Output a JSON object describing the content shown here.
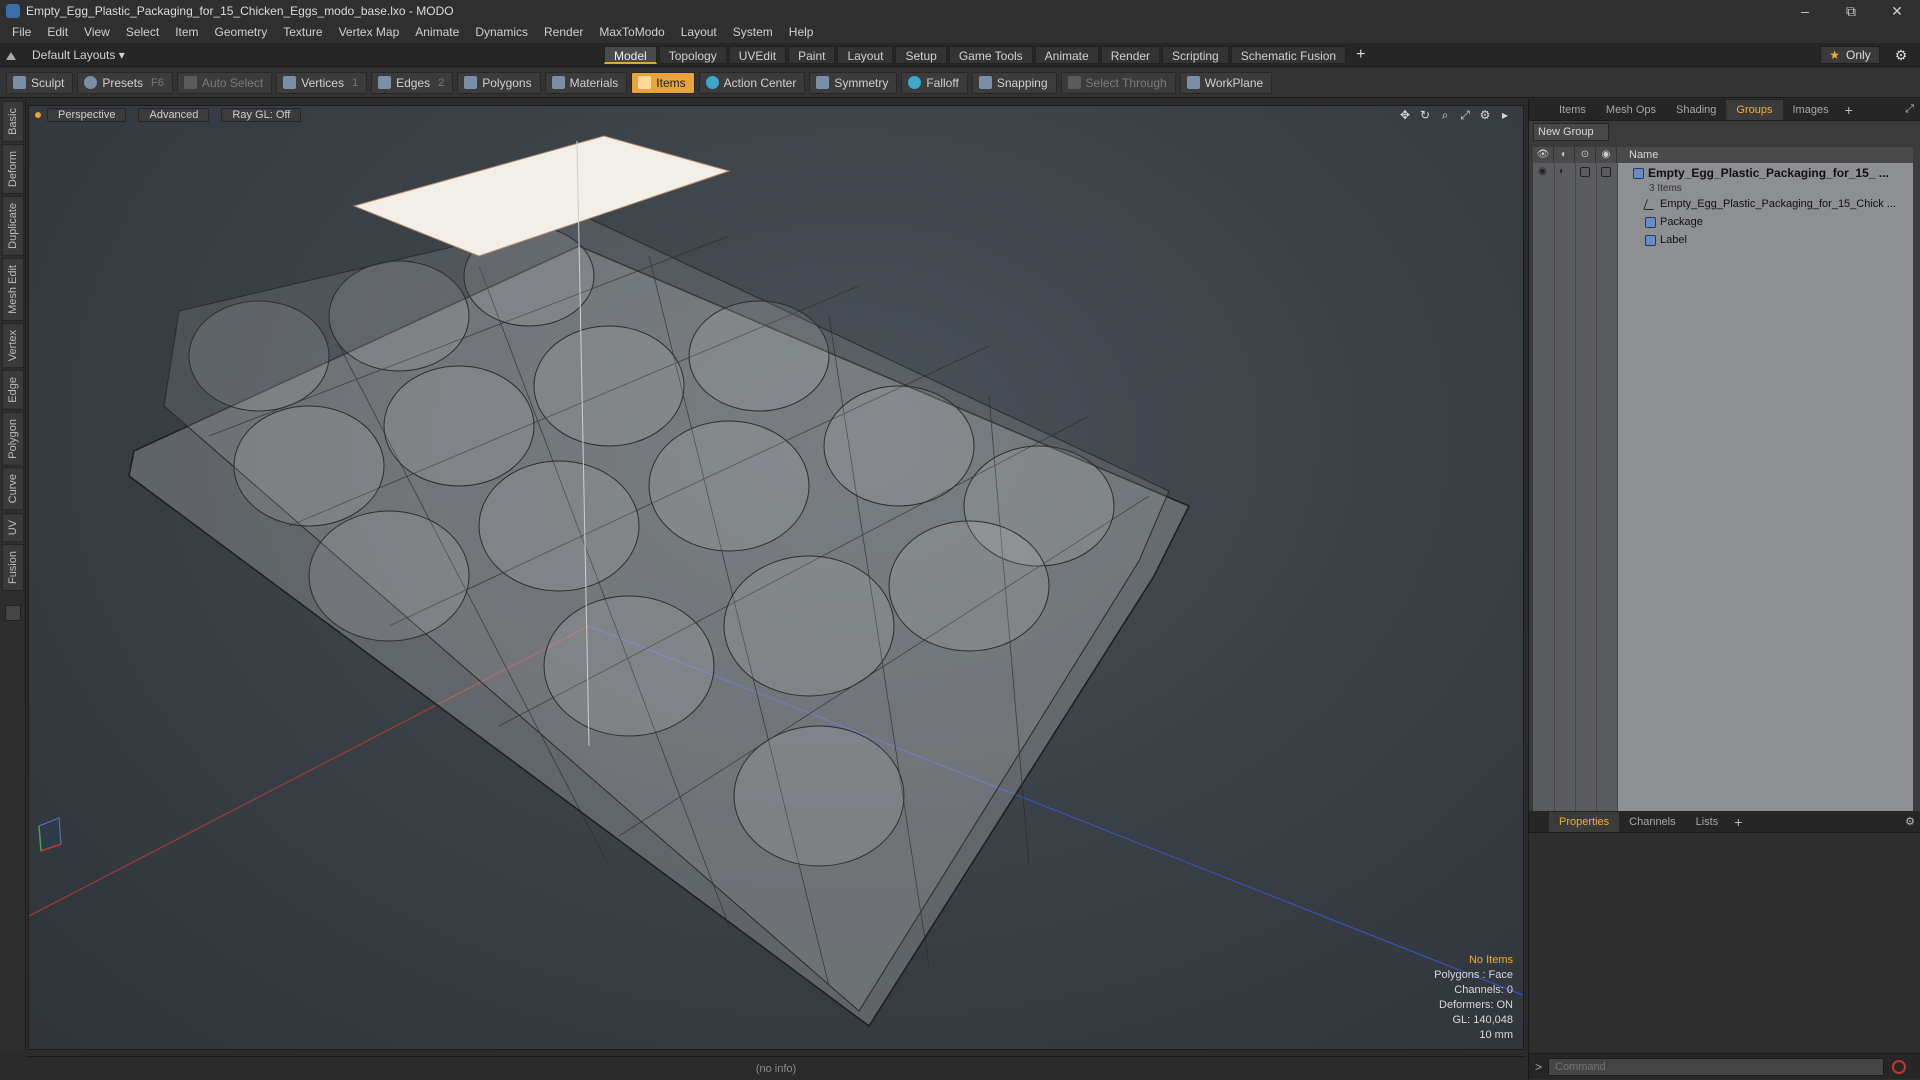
{
  "window": {
    "title": "Empty_Egg_Plastic_Packaging_for_15_Chicken_Eggs_modo_base.lxo - MODO",
    "minimize": "–",
    "maximize": "⧉",
    "close": "✕"
  },
  "menu": [
    "File",
    "Edit",
    "View",
    "Select",
    "Item",
    "Geometry",
    "Texture",
    "Vertex Map",
    "Animate",
    "Dynamics",
    "Render",
    "MaxToModo",
    "Layout",
    "System",
    "Help"
  ],
  "layout_selector": "Default Layouts ▾",
  "tabs": [
    "Model",
    "Topology",
    "UVEdit",
    "Paint",
    "Layout",
    "Setup",
    "Game Tools",
    "Animate",
    "Render",
    "Scripting",
    "Schematic Fusion"
  ],
  "active_tab": "Model",
  "tab_plus": "+",
  "only_label": "Only",
  "toolbar": {
    "sculpt": "Sculpt",
    "presets": "Presets",
    "presets_key": "F6",
    "auto_select": "Auto Select",
    "vertices": "Vertices",
    "vertices_key": "1",
    "edges": "Edges",
    "edges_key": "2",
    "polygons": "Polygons",
    "materials": "Materials",
    "items": "Items",
    "action_center": "Action Center",
    "symmetry": "Symmetry",
    "falloff": "Falloff",
    "snapping": "Snapping",
    "select_through": "Select Through",
    "workplane": "WorkPlane"
  },
  "left_palette": [
    "Basic",
    "Deform",
    "Duplicate",
    "Mesh Edit",
    "Vertex",
    "Edge",
    "Polygon",
    "Curve",
    "UV",
    "Fusion"
  ],
  "viewport": {
    "perspective": "Perspective",
    "advanced": "Advanced",
    "raygl": "Ray GL: Off",
    "info": {
      "no_items": "No Items",
      "polygons": "Polygons : Face",
      "channels": "Channels: 0",
      "deformers": "Deformers: ON",
      "gl": "GL: 140,048",
      "size": "10 mm"
    }
  },
  "status": "(no info)",
  "right_panel": {
    "tabs": [
      "Items",
      "Mesh Ops",
      "Shading",
      "Groups",
      "Images"
    ],
    "active_tab": "Groups",
    "new_group": "New Group",
    "name_header": "Name",
    "tree": {
      "group_name": "Empty_Egg_Plastic_Packaging_for_15_ ...",
      "group_count": "3 Items",
      "children": [
        "Empty_Egg_Plastic_Packaging_for_15_Chick ...",
        "Package",
        "Label"
      ]
    },
    "props_tabs": [
      "Properties",
      "Channels",
      "Lists"
    ],
    "props_active": "Properties",
    "command_placeholder": "Command",
    "prompt": ">"
  },
  "colors": {
    "accent": "#e8a33a",
    "info_warn": "#f0b030",
    "axis_red": "#c0392b",
    "axis_blue": "#3b55c8"
  }
}
